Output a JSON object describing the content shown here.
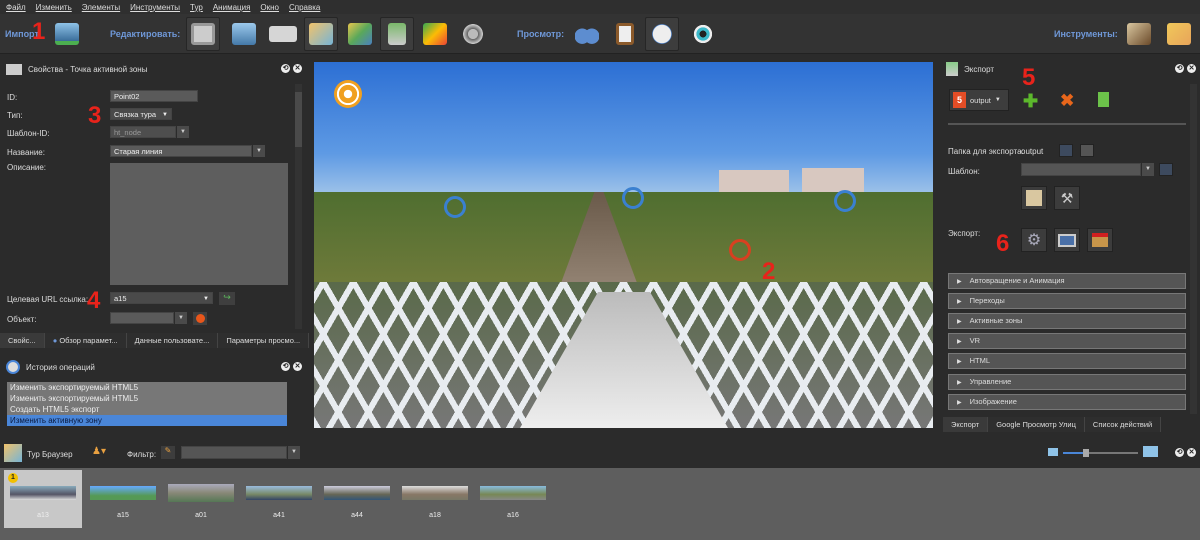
{
  "menu": [
    "Файл",
    "Изменить",
    "Элементы",
    "Инструменты",
    "Тур",
    "Анимация",
    "Окно",
    "Справка"
  ],
  "toolbar": {
    "import_label": "Импорт",
    "edit_label": "Редактировать:",
    "view_label": "Просмотр:",
    "tools_label": "Инструменты:"
  },
  "annotations": [
    "1",
    "2",
    "3",
    "4",
    "5",
    "6"
  ],
  "properties": {
    "title": "Свойства - Точка активной зоны",
    "id_label": "ID:",
    "id_value": "Point02",
    "type_label": "Тип:",
    "type_value": "Связка тура",
    "template_label": "Шаблон-ID:",
    "template_value": "ht_node",
    "name_label": "Название:",
    "name_value": "Старая линия",
    "desc_label": "Описание:",
    "url_label": "Целевая URL ссылка:",
    "url_value": "a15",
    "object_label": "Объект:",
    "tabs": [
      "Свойс...",
      "Обзор парамет...",
      "Данные пользовате...",
      "Параметры просмо..."
    ]
  },
  "history": {
    "title": "История операций",
    "items": [
      "Изменить экспортируемый HTML5",
      "Изменить экспортируемый HTML5",
      "Создать HTML5 экспорт",
      "Изменить активную зону"
    ],
    "selected": 3
  },
  "export": {
    "title": "Экспорт",
    "profile": "output",
    "folder_label": "Папка для экспорта:",
    "folder_value": "output",
    "template_label": "Шаблон:",
    "export_label": "Экспорт:",
    "sections": [
      "Автовращение и Анимация",
      "Переходы",
      "Активные зоны",
      "VR",
      "HTML",
      "Управление",
      "Изображение"
    ],
    "tabs": [
      "Экспорт",
      "Google Просмотр Улиц",
      "Список действий"
    ]
  },
  "browser": {
    "title": "Тур Браузер",
    "filter_label": "Фильтр:",
    "badge": "1",
    "zoom_level": 0.3,
    "items": [
      "a13",
      "a15",
      "a01",
      "a41",
      "a44",
      "a18",
      "a16"
    ],
    "selected": 0
  },
  "colors": {
    "accent": "#4a86d8",
    "annotation": "#e8231b",
    "toolbar_label": "#6f98d8"
  }
}
